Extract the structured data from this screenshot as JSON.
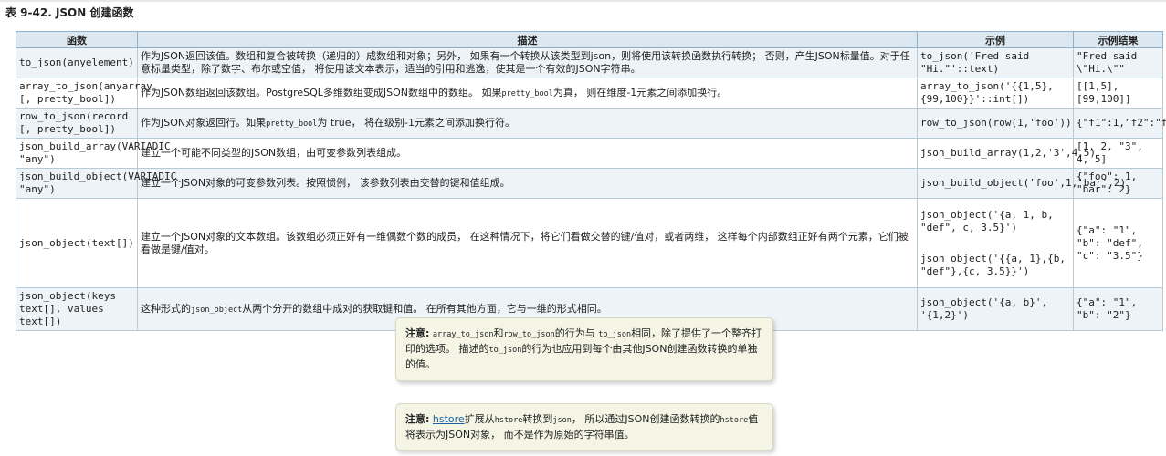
{
  "caption": "表 9-42. JSON 创建函数",
  "headers": [
    "函数",
    "描述",
    "示例",
    "示例结果"
  ],
  "rows": [
    {
      "func": "to_json(anyelement)",
      "desc": "作为JSON返回该值。数组和复合被转换（递归的）成数组和对象；另外， 如果有一个转换从该类型到json，则将使用该转换函数执行转换； 否则，产生JSON标量值。对于任意标量类型，除了数字、布尔或空值， 将使用该文本表示，适当的引用和逃逸，使其是一个有效的JSON字符串。",
      "example": "to_json('Fred said \"Hi.\"'::text)",
      "result": "\"Fred said \\\"Hi.\\\"\""
    },
    {
      "func": "array_to_json(anyarray [, pretty_bool])",
      "desc_a": "作为JSON数组返回该数组。PostgreSQL多维数组变成JSON数组中的数组。 如果",
      "desc_code": "pretty_bool",
      "desc_b": "为真， 则在维度-1元素之间添加换行。",
      "example": "array_to_json('{{1,5},{99,100}}'::int[])",
      "result": "[[1,5],[99,100]]"
    },
    {
      "func": "row_to_json(record [, pretty_bool])",
      "desc_a": "作为JSON对象返回行。如果",
      "desc_code": "pretty_bool",
      "desc_b": "为 true， 将在级别-1元素之间添加换行符。",
      "example": "row_to_json(row(1,'foo'))",
      "result": "{\"f1\":1,\"f2\":\"foo\"}"
    },
    {
      "func": "json_build_array(VARIADIC \"any\")",
      "desc": "建立一个可能不同类型的JSON数组，由可变参数列表组成。",
      "example": "json_build_array(1,2,'3',4,5)",
      "result": "[1, 2, \"3\", 4, 5]"
    },
    {
      "func": "json_build_object(VARIADIC \"any\")",
      "desc": "建立一个JSON对象的可变参数列表。按照惯例， 该参数列表由交替的键和值组成。",
      "example": "json_build_object('foo',1,'bar',2)",
      "result": "{\"foo\": 1, \"bar\": 2}"
    },
    {
      "func": "json_object(text[])",
      "desc": "建立一个JSON对象的文本数组。该数组必须正好有一维偶数个数的成员， 在这种情况下，将它们看做交替的键/值对，或者两维， 这样每个内部数组正好有两个元素，它们被看做是键/值对。",
      "example": "json_object('{a, 1, b, \"def\", c, 3.5}')",
      "example2": "json_object('{{a, 1},{b, \"def\"},{c, 3.5}}')",
      "result": "{\"a\": \"1\", \"b\": \"def\", \"c\": \"3.5\"}"
    },
    {
      "func": "json_object(keys text[], values text[])",
      "desc_a": "这种形式的",
      "desc_code": "json_object",
      "desc_b": "从两个分开的数组中成对的获取键和值。 在所有其他方面，它与一维的形式相同。",
      "example": "json_object('{a, b}', '{1,2}')",
      "result": "{\"a\": \"1\", \"b\": \"2\"}"
    }
  ],
  "note1": {
    "label": "注意:",
    "code1": "array_to_json",
    "t1": "和",
    "code2": "row_to_json",
    "t2": "的行为与",
    "code3": "to_json",
    "t3": "相同，除了提供了一个整齐打印的选项。 描述的",
    "code4": "to_json",
    "t4": "的行为也应用到每个由其他JSON创建函数转换的单独的值。"
  },
  "note2": {
    "label": "注意:",
    "link": "hstore",
    "t1": "扩展从",
    "code1": "hstore",
    "t2": "转换到",
    "code2": "json",
    "t3": "， 所以通过JSON创建函数转换的",
    "code3": "hstore",
    "t4": "值将表示为JSON对象， 而不是作为原始的字符串值。"
  }
}
